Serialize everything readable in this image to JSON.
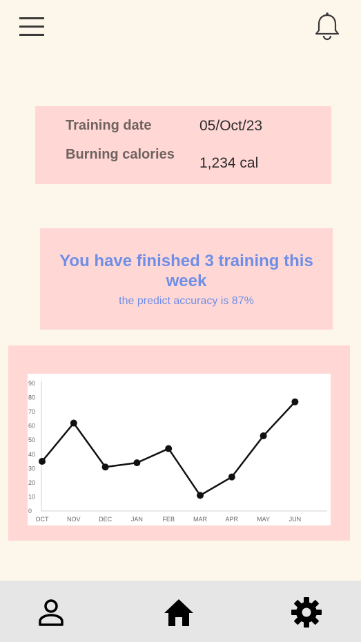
{
  "header": {
    "menu_icon": "hamburger-menu-icon",
    "notification_icon": "bell-icon"
  },
  "training_info": {
    "date_label": "Training date",
    "date_value": "05/Oct/23",
    "calories_label": "Burning calories",
    "calories_value": "1,234 cal"
  },
  "summary": {
    "title": "You have finished 3 training this week",
    "subtitle": "the predict accuracy is 87%"
  },
  "chart_data": {
    "type": "line",
    "categories": [
      "OCT",
      "NOV",
      "DEC",
      "JAN",
      "FEB",
      "MAR",
      "APR",
      "MAY",
      "JUN"
    ],
    "series": [
      {
        "values": [
          35,
          62,
          31,
          34,
          44,
          11,
          24,
          53,
          77
        ]
      }
    ],
    "yticks": [
      0,
      10,
      20,
      30,
      40,
      50,
      60,
      70,
      80,
      90
    ],
    "ylim": [
      0,
      90
    ],
    "title": "",
    "xlabel": "",
    "ylabel": "",
    "grid": false,
    "line_color": "#111111"
  },
  "bottom_nav": {
    "items": [
      {
        "name": "profile",
        "icon": "person-icon"
      },
      {
        "name": "home",
        "icon": "home-icon"
      },
      {
        "name": "settings",
        "icon": "gear-icon"
      }
    ]
  },
  "colors": {
    "background": "#fdf6ea",
    "card": "#ffd8d6",
    "accent_text": "#6f8ee6",
    "nav_bar": "#e6e6e6"
  }
}
